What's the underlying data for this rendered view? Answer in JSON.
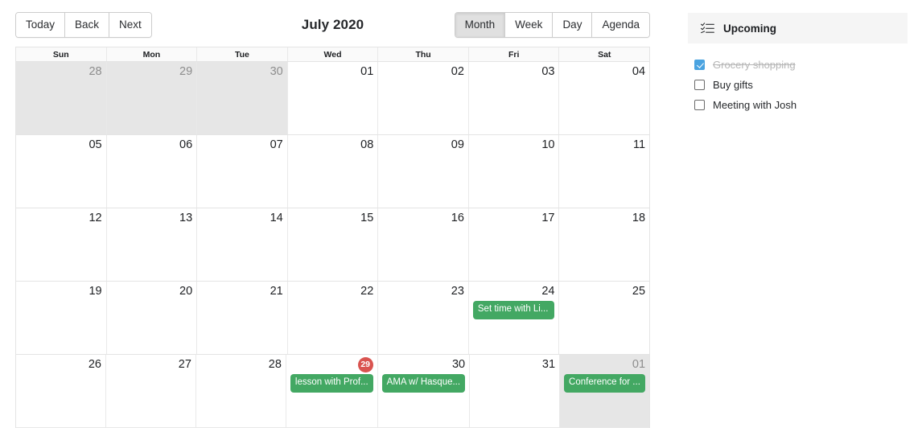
{
  "calendar": {
    "title": "July 2020",
    "nav_buttons": [
      {
        "label": "Today",
        "name": "today-button",
        "active": false
      },
      {
        "label": "Back",
        "name": "back-button",
        "active": false
      },
      {
        "label": "Next",
        "name": "next-button",
        "active": false
      }
    ],
    "view_buttons": [
      {
        "label": "Month",
        "name": "view-month-button",
        "active": true
      },
      {
        "label": "Week",
        "name": "view-week-button",
        "active": false
      },
      {
        "label": "Day",
        "name": "view-day-button",
        "active": false
      },
      {
        "label": "Agenda",
        "name": "view-agenda-button",
        "active": false
      }
    ],
    "day_headers": [
      "Sun",
      "Mon",
      "Tue",
      "Wed",
      "Thu",
      "Fri",
      "Sat"
    ],
    "accent_event_color": "#43a863",
    "today_badge_color": "#d9534f",
    "off_month_bg": "#e6e6e6",
    "weeks": [
      [
        {
          "date": "28",
          "off_month": true,
          "today": false,
          "events": []
        },
        {
          "date": "29",
          "off_month": true,
          "today": false,
          "events": []
        },
        {
          "date": "30",
          "off_month": true,
          "today": false,
          "events": []
        },
        {
          "date": "01",
          "off_month": false,
          "today": false,
          "events": []
        },
        {
          "date": "02",
          "off_month": false,
          "today": false,
          "events": []
        },
        {
          "date": "03",
          "off_month": false,
          "today": false,
          "events": []
        },
        {
          "date": "04",
          "off_month": false,
          "today": false,
          "events": []
        }
      ],
      [
        {
          "date": "05",
          "off_month": false,
          "today": false,
          "events": []
        },
        {
          "date": "06",
          "off_month": false,
          "today": false,
          "events": []
        },
        {
          "date": "07",
          "off_month": false,
          "today": false,
          "events": []
        },
        {
          "date": "08",
          "off_month": false,
          "today": false,
          "events": []
        },
        {
          "date": "09",
          "off_month": false,
          "today": false,
          "events": []
        },
        {
          "date": "10",
          "off_month": false,
          "today": false,
          "events": []
        },
        {
          "date": "11",
          "off_month": false,
          "today": false,
          "events": []
        }
      ],
      [
        {
          "date": "12",
          "off_month": false,
          "today": false,
          "events": []
        },
        {
          "date": "13",
          "off_month": false,
          "today": false,
          "events": []
        },
        {
          "date": "14",
          "off_month": false,
          "today": false,
          "events": []
        },
        {
          "date": "15",
          "off_month": false,
          "today": false,
          "events": []
        },
        {
          "date": "16",
          "off_month": false,
          "today": false,
          "events": []
        },
        {
          "date": "17",
          "off_month": false,
          "today": false,
          "events": []
        },
        {
          "date": "18",
          "off_month": false,
          "today": false,
          "events": []
        }
      ],
      [
        {
          "date": "19",
          "off_month": false,
          "today": false,
          "events": []
        },
        {
          "date": "20",
          "off_month": false,
          "today": false,
          "events": []
        },
        {
          "date": "21",
          "off_month": false,
          "today": false,
          "events": []
        },
        {
          "date": "22",
          "off_month": false,
          "today": false,
          "events": []
        },
        {
          "date": "23",
          "off_month": false,
          "today": false,
          "events": []
        },
        {
          "date": "24",
          "off_month": false,
          "today": false,
          "events": [
            "Set time with Li..."
          ]
        },
        {
          "date": "25",
          "off_month": false,
          "today": false,
          "events": []
        }
      ],
      [
        {
          "date": "26",
          "off_month": false,
          "today": false,
          "events": []
        },
        {
          "date": "27",
          "off_month": false,
          "today": false,
          "events": []
        },
        {
          "date": "28",
          "off_month": false,
          "today": false,
          "events": []
        },
        {
          "date": "29",
          "off_month": false,
          "today": true,
          "events": [
            "lesson with Prof..."
          ]
        },
        {
          "date": "30",
          "off_month": false,
          "today": false,
          "events": [
            "AMA w/ Hasque..."
          ]
        },
        {
          "date": "31",
          "off_month": false,
          "today": false,
          "events": []
        },
        {
          "date": "01",
          "off_month": true,
          "today": false,
          "events": [
            "Conference for ..."
          ]
        }
      ]
    ]
  },
  "upcoming": {
    "title": "Upcoming",
    "icon": "checklist-icon",
    "items": [
      {
        "label": "Grocery shopping",
        "checked": true
      },
      {
        "label": "Buy gifts",
        "checked": false
      },
      {
        "label": "Meeting with Josh",
        "checked": false
      }
    ]
  }
}
